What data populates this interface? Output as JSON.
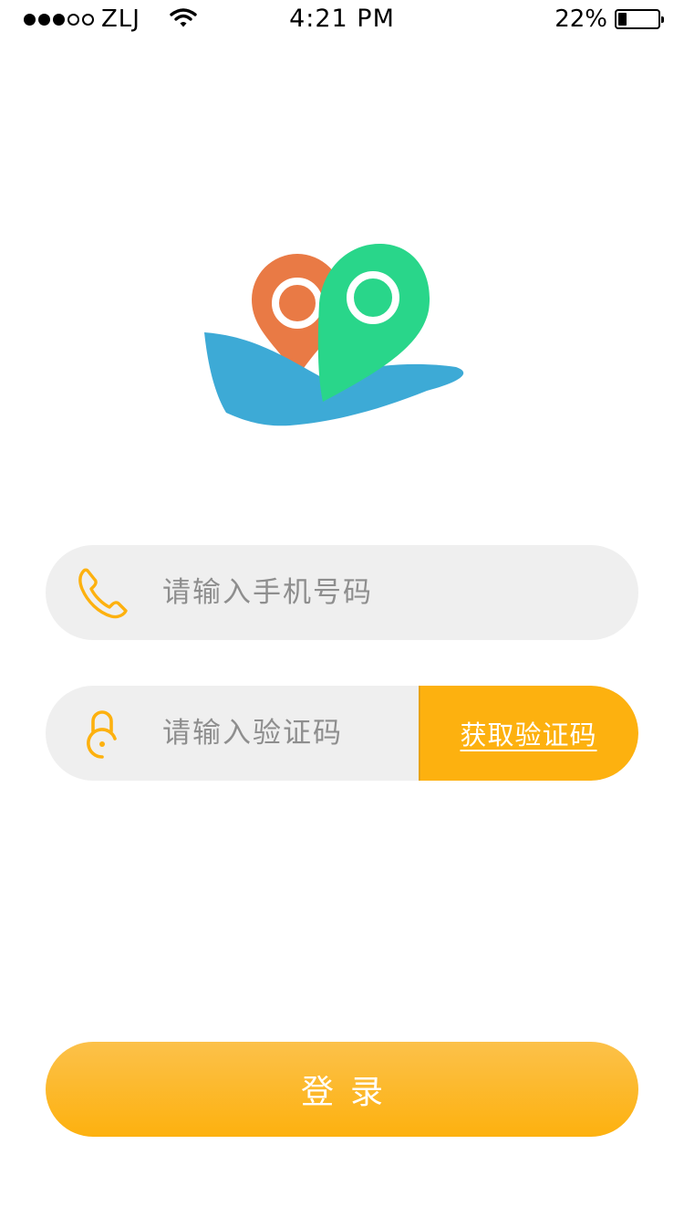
{
  "status_bar": {
    "carrier": "ZLJ",
    "time": "4:21 PM",
    "battery": "22%",
    "battery_level": 0.22,
    "signal_strength": 3,
    "signal_max": 5
  },
  "colors": {
    "accent": "#fdb10f",
    "input_bg": "#efefef",
    "placeholder": "#8e8e8e",
    "logo_blue": "#3daad6",
    "logo_orange": "#e97a45",
    "logo_green": "#29d68a"
  },
  "icons": {
    "phone": "phone-icon",
    "lock": "lock-icon",
    "logo": "map-pin-logo"
  },
  "form": {
    "phone_placeholder": "请输入手机号码",
    "phone_value": "",
    "code_placeholder": "请输入验证码",
    "code_value": "",
    "get_code_label": "获取验证码"
  },
  "login_label": "登录"
}
